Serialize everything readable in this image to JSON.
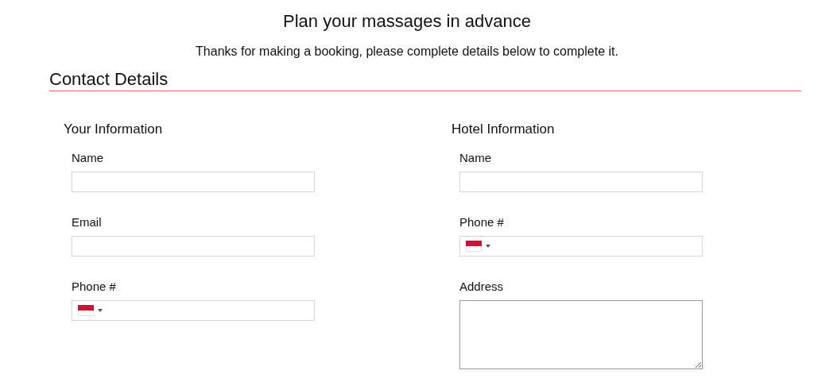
{
  "title": "Plan your massages in advance",
  "subtitle": "Thanks for making a booking, please complete details below to complete it.",
  "section": {
    "title": "Contact Details"
  },
  "groups": [
    {
      "title": "Your Information",
      "fields": [
        {
          "kind": "text",
          "label": "Name"
        },
        {
          "kind": "text",
          "label": "Email"
        },
        {
          "kind": "phone",
          "label": "Phone #"
        }
      ]
    },
    {
      "title": "Hotel Information",
      "fields": [
        {
          "kind": "text",
          "label": "Name"
        },
        {
          "kind": "phone",
          "label": "Phone #"
        },
        {
          "kind": "textarea",
          "label": "Address"
        }
      ]
    }
  ]
}
